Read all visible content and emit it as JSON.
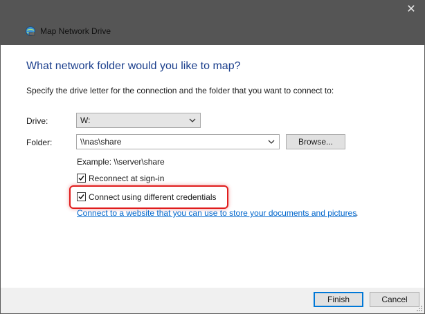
{
  "window": {
    "close_glyph": "✕"
  },
  "header": {
    "title": "Map Network Drive",
    "icon": "network-drive-icon"
  },
  "main": {
    "heading": "What network folder would you like to map?",
    "description": "Specify the drive letter for the connection and the folder that you want to connect to:",
    "drive": {
      "label": "Drive:",
      "value": "W:"
    },
    "folder": {
      "label": "Folder:",
      "value": "\\\\nas\\share",
      "browse_label": "Browse..."
    },
    "example": "Example: \\\\server\\share",
    "reconnect": {
      "label": "Reconnect at sign-in",
      "checked": true
    },
    "credentials": {
      "label": "Connect using different credentials",
      "checked": true
    },
    "link": {
      "text": "Connect to a website that you can use to store your documents and pictures",
      "suffix": "."
    }
  },
  "footer": {
    "finish_label": "Finish",
    "cancel_label": "Cancel"
  },
  "colors": {
    "accent": "#0078d7",
    "heading": "#1a3e8c",
    "link": "#0066cc",
    "highlight": "#e01c1c",
    "titlebar": "#555555"
  }
}
